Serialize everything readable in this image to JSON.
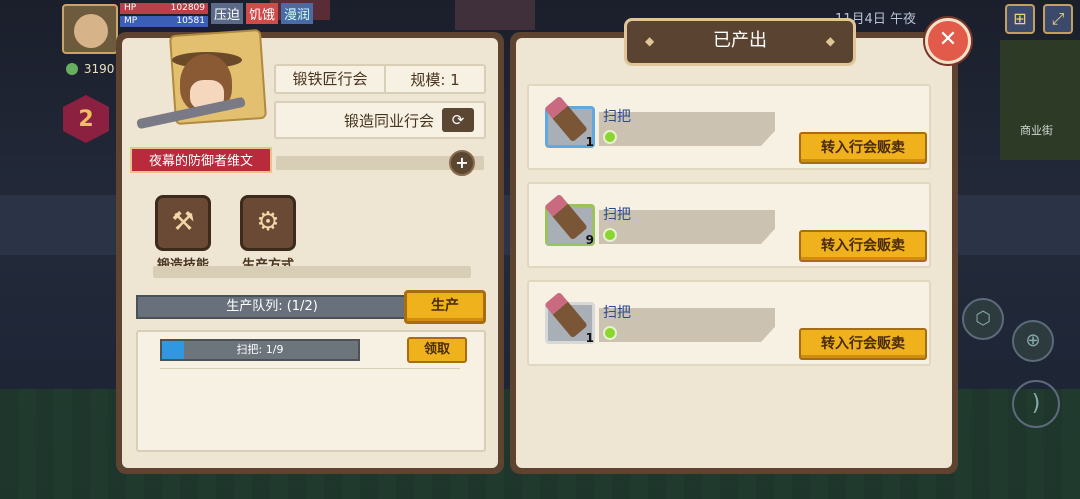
{
  "hud": {
    "hp_label": "HP",
    "hp_value": "102809",
    "mp_label": "MP",
    "mp_value": "10581",
    "status_tags": [
      "压迫",
      "饥饿",
      "漫润"
    ],
    "currency": "3190",
    "level": "2",
    "date": "11月4日",
    "time_of_day": "午夜",
    "street_label": "商业街"
  },
  "left": {
    "character_name": "夜幕的防御者维文",
    "guild_name": "锻铁匠行会",
    "scale_label": "规模: 1",
    "association_label": "锻造同业行会",
    "skills": [
      {
        "label": "锻造技能",
        "icon": "anvil-icon"
      },
      {
        "label": "生产方式",
        "icon": "robot-arm-icon"
      }
    ],
    "queue_label": "生产队列: (1/2)",
    "produce_label": "生产",
    "job": {
      "text": "扫把: 1/9",
      "progress": 0.11,
      "claim_label": "领取"
    }
  },
  "right": {
    "title": "已产出",
    "items": [
      {
        "name": "扫把",
        "qty": "1",
        "frame": "blue",
        "action": "转入行会贩卖"
      },
      {
        "name": "扫把",
        "qty": "9",
        "frame": "green",
        "action": "转入行会贩卖"
      },
      {
        "name": "扫把",
        "qty": "1",
        "frame": "gray",
        "action": "转入行会贩卖"
      }
    ]
  },
  "colors": {
    "accent_button": "#efb21c",
    "panel_frame": "#5d4330",
    "panel_bg": "#eee6d2",
    "banner_red": "#b82a3c",
    "close_red": "#e25a4a"
  }
}
